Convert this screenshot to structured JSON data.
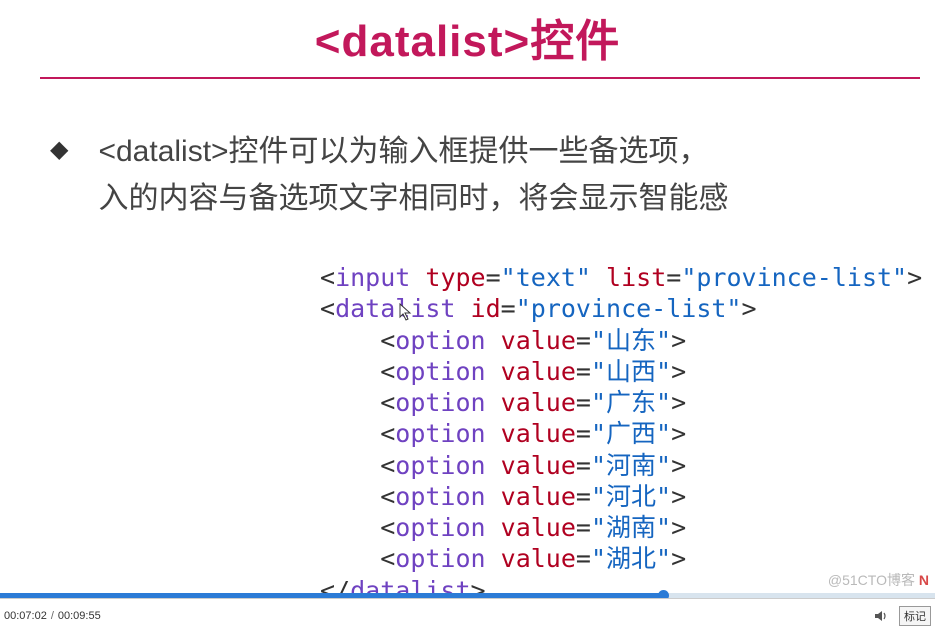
{
  "title": {
    "open": "<datalist>",
    "suffix": "控件"
  },
  "bullet": {
    "line1": "<datalist>控件可以为输入框提供一些备选项，",
    "line2": "入的内容与备选项文字相同时，将会显示智能感"
  },
  "code": {
    "input_tag": "input",
    "type_attr": "type",
    "type_val": "\"text\"",
    "list_attr": "list",
    "list_val": "\"province-list\"",
    "datalist_tag": "datalist",
    "id_attr": "id",
    "id_val": "\"province-list\"",
    "option_tag": "option",
    "value_attr": "value",
    "options": [
      "\"山东\"",
      "\"山西\"",
      "\"广东\"",
      "\"广西\"",
      "\"河南\"",
      "\"河北\"",
      "\"湖南\"",
      "\"湖北\""
    ],
    "close_datalist": "datalist"
  },
  "player": {
    "current": "00:07:02",
    "total": "00:09:55",
    "note_label": "标记"
  },
  "watermark": "@51CTO博客"
}
